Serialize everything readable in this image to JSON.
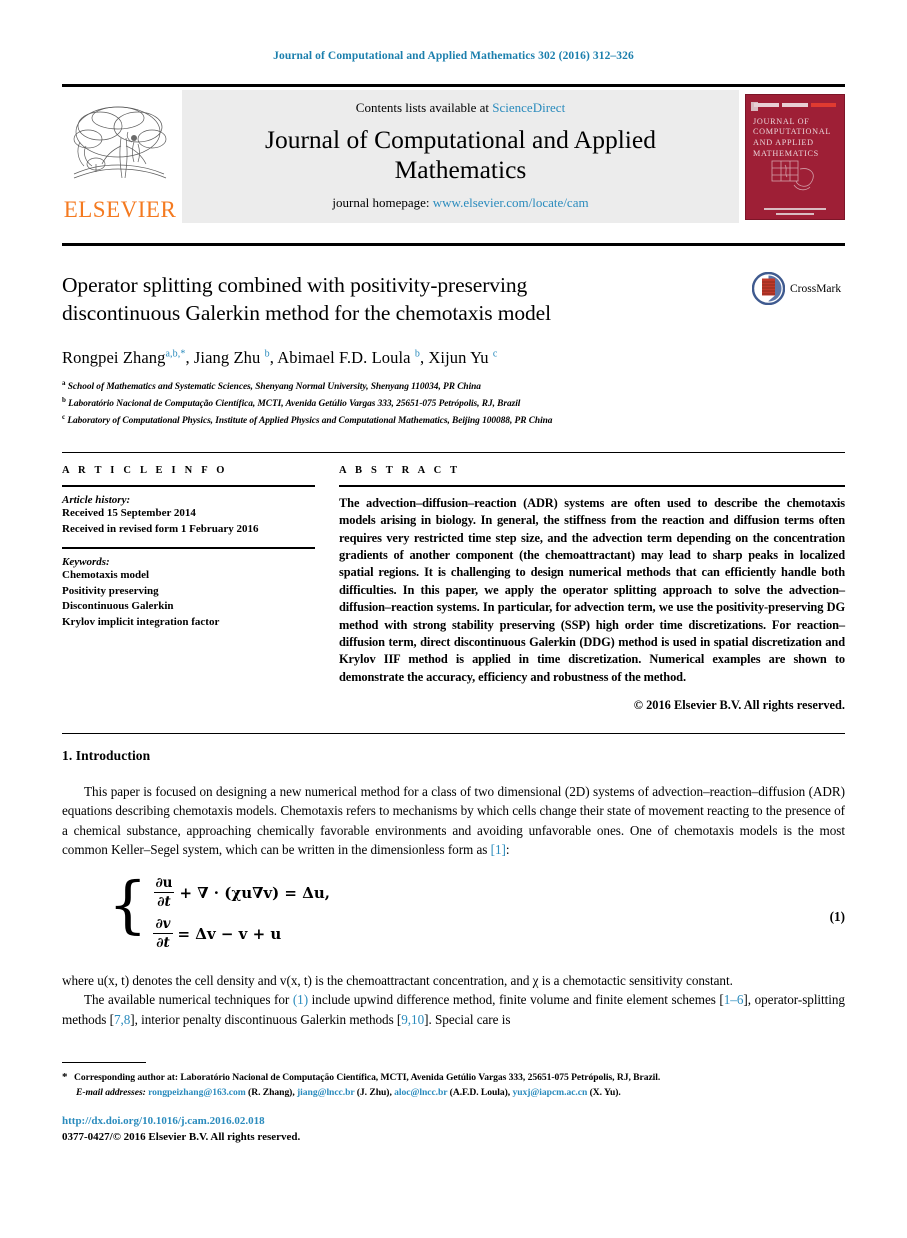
{
  "running_head": "Journal of Computational and Applied Mathematics 302 (2016) 312–326",
  "masthead": {
    "contents_prefix": "Contents lists available at ",
    "contents_link": "ScienceDirect",
    "journal_title_line1": "Journal of Computational and Applied",
    "journal_title_line2": "Mathematics",
    "homepage_prefix": "journal homepage: ",
    "homepage_url": "www.elsevier.com/locate/cam",
    "publisher": "ELSEVIER",
    "cover_title": "JOURNAL OF COMPUTATIONAL AND APPLIED MATHEMATICS"
  },
  "article": {
    "title_line1": "Operator splitting combined with positivity-preserving",
    "title_line2": "discontinuous Galerkin method for the chemotaxis model",
    "authors": [
      {
        "name": "Rongpei Zhang",
        "sup": "a,b,*"
      },
      {
        "name": "Jiang Zhu",
        "sup": "b"
      },
      {
        "name": "Abimael F.D. Loula",
        "sup": "b"
      },
      {
        "name": "Xijun Yu",
        "sup": "c"
      }
    ],
    "affiliations": [
      {
        "mark": "a",
        "text": "School of Mathematics and Systematic Sciences, Shenyang Normal University, Shenyang 110034, PR China"
      },
      {
        "mark": "b",
        "text": "Laboratório Nacional de Computação Científica, MCTI, Avenida Getúlio Vargas 333, 25651-075 Petrópolis, RJ, Brazil"
      },
      {
        "mark": "c",
        "text": "Laboratory of Computational Physics, Institute of Applied Physics and Computational Mathematics, Beijing 100088, PR China"
      }
    ],
    "crossmark_label": "CrossMark"
  },
  "info": {
    "heading": "A R T I C L E   I N F O",
    "history_title": "Article history:",
    "history": [
      "Received 15 September 2014",
      "Received in revised form 1 February 2016"
    ],
    "keywords_title": "Keywords:",
    "keywords": [
      "Chemotaxis model",
      "Positivity preserving",
      "Discontinuous Galerkin",
      "Krylov implicit integration factor"
    ]
  },
  "abstract": {
    "heading": "A B S T R A C T",
    "body": "The advection–diffusion–reaction (ADR) systems are often used to describe the chemotaxis models arising in biology. In general, the stiffness from the reaction and diffusion terms often requires very restricted time step size, and the advection term depending on the concentration gradients of another component (the chemoattractant) may lead to sharp peaks in localized spatial regions. It is challenging to design numerical methods that can efficiently handle both difficulties. In this paper, we apply the operator splitting approach to solve the advection–diffusion–reaction systems. In particular, for advection term, we use the positivity-preserving DG method with strong stability preserving (SSP) high order time discretizations. For reaction–diffusion term, direct discontinuous Galerkin (DDG) method is used in spatial discretization and Krylov IIF method is applied in time discretization. Numerical examples are shown to demonstrate the accuracy, efficiency and robustness of the method.",
    "copyright": "© 2016 Elsevier B.V. All rights reserved."
  },
  "body": {
    "section_heading": "1. Introduction",
    "para1_a": "This paper is focused on designing a new numerical method for a class of two dimensional (2D) systems of advection–reaction–diffusion (ADR) equations describing chemotaxis models. Chemotaxis refers to mechanisms by which cells change their state of movement reacting to the presence of a chemical substance, approaching chemically favorable environments and avoiding unfavorable ones. One of chemotaxis models is the most common Keller–Segel system, which can be written in the dimensionless form as ",
    "para1_ref": "[1]",
    "para1_b": ":",
    "equation": {
      "line1_num": "∂u",
      "line1_den": "∂t",
      "line1_rest": "+ ∇ · (χu∇v) = Δu,",
      "line2_num": "∂v",
      "line2_den": "∂t",
      "line2_rest": "= Δv − v + u",
      "number": "(1)"
    },
    "para2": "where u(x, t) denotes the cell density and v(x, t) is the chemoattractant concentration, and χ is a chemotactic sensitivity constant.",
    "para3_a": "The available numerical techniques for ",
    "para3_ref1": "(1)",
    "para3_b": " include upwind difference method, finite volume and finite element schemes [",
    "para3_ref2": "1–6",
    "para3_c": "], operator-splitting methods [",
    "para3_ref3": "7,8",
    "para3_d": "], interior penalty discontinuous Galerkin methods [",
    "para3_ref4": "9,10",
    "para3_e": "]. Special care is"
  },
  "footer": {
    "corresponding_star": "*",
    "corresponding": "Corresponding author at: Laboratório Nacional de Computação Científica, MCTI, Avenida Getúlio Vargas 333, 25651-075 Petrópolis, RJ, Brazil.",
    "email_label": "E-mail addresses:",
    "emails": [
      {
        "addr": "rongpeizhang@163.com",
        "who": " (R. Zhang), "
      },
      {
        "addr": "jiang@lncc.br",
        "who": " (J. Zhu), "
      },
      {
        "addr": "aloc@lncc.br",
        "who": " (A.F.D. Loula), "
      },
      {
        "addr": "yuxj@iapcm.ac.cn",
        "who": " (X. Yu)."
      }
    ],
    "doi": "http://dx.doi.org/10.1016/j.cam.2016.02.018",
    "issn": "0377-0427/© 2016 Elsevier B.V. All rights reserved."
  },
  "colors": {
    "link": "#2a8bbd",
    "running_head": "#1b7fad",
    "elsevier_orange": "#f47a20",
    "cover_red": "#9e1f36"
  }
}
